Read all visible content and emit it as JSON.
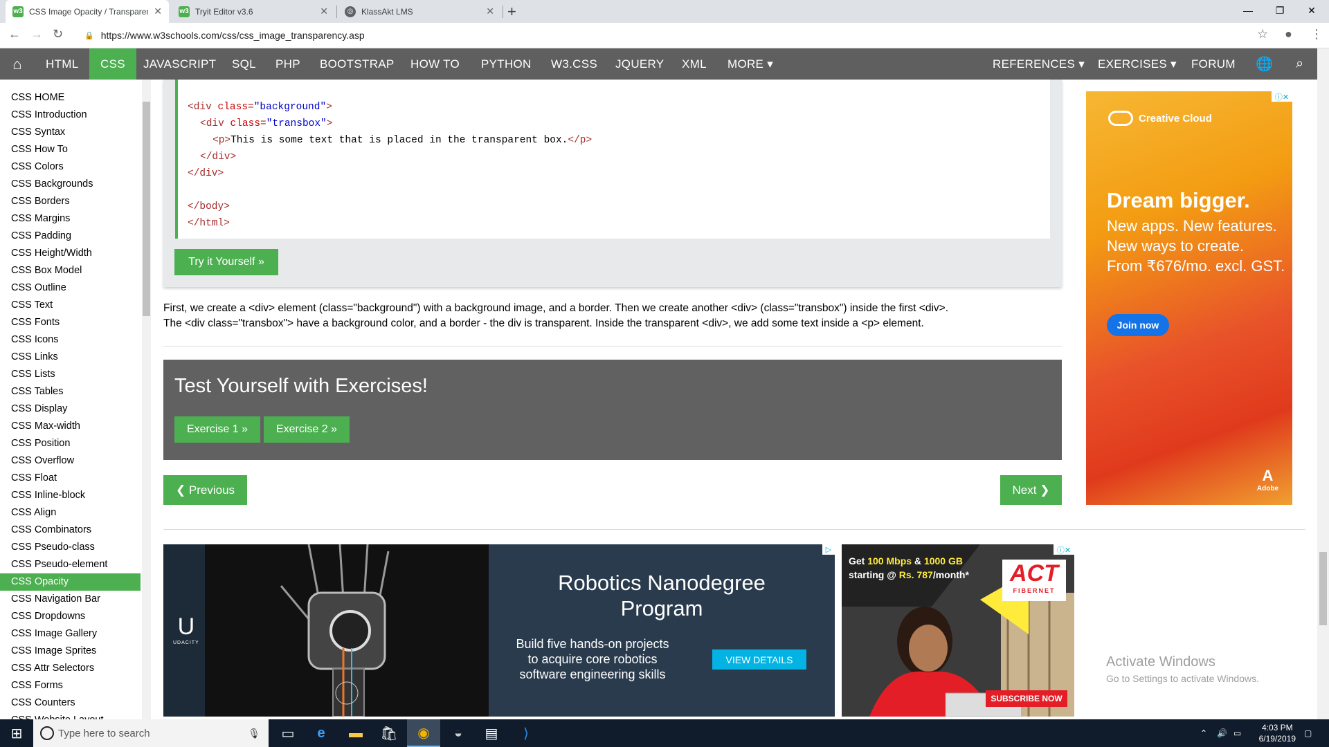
{
  "browser": {
    "tabs": [
      {
        "title": "CSS Image Opacity / Transparency",
        "active": true
      },
      {
        "title": "Tryit Editor v3.6",
        "active": false
      },
      {
        "title": "KlassAkt LMS",
        "active": false
      }
    ],
    "url": "https://www.w3schools.com/css/css_image_transparency.asp"
  },
  "navbar": {
    "items": [
      "HTML",
      "CSS",
      "JAVASCRIPT",
      "SQL",
      "PHP",
      "BOOTSTRAP",
      "HOW TO",
      "PYTHON",
      "W3.CSS",
      "JQUERY",
      "XML",
      "MORE ▾"
    ],
    "right_items": [
      "REFERENCES ▾",
      "EXERCISES ▾",
      "FORUM"
    ],
    "active": "CSS"
  },
  "sidebar": {
    "items": [
      "CSS HOME",
      "CSS Introduction",
      "CSS Syntax",
      "CSS How To",
      "CSS Colors",
      "CSS Backgrounds",
      "CSS Borders",
      "CSS Margins",
      "CSS Padding",
      "CSS Height/Width",
      "CSS Box Model",
      "CSS Outline",
      "CSS Text",
      "CSS Fonts",
      "CSS Icons",
      "CSS Links",
      "CSS Lists",
      "CSS Tables",
      "CSS Display",
      "CSS Max-width",
      "CSS Position",
      "CSS Overflow",
      "CSS Float",
      "CSS Inline-block",
      "CSS Align",
      "CSS Combinators",
      "CSS Pseudo-class",
      "CSS Pseudo-element",
      "CSS Opacity",
      "CSS Navigation Bar",
      "CSS Dropdowns",
      "CSS Image Gallery",
      "CSS Image Sprites",
      "CSS Attr Selectors",
      "CSS Forms",
      "CSS Counters",
      "CSS Website Layout"
    ],
    "active": "CSS Opacity"
  },
  "code": {
    "line1_open": "<div ",
    "line1_attr": "class",
    "line1_eq": "=",
    "line1_val": "\"background\"",
    "line1_close": ">",
    "line2_open": "<div ",
    "line2_attr": "class",
    "line2_eq": "=",
    "line2_val": "\"transbox\"",
    "line2_close": ">",
    "line3_open": "<p>",
    "line3_text": "This is some text that is placed in the transparent box.",
    "line3_close": "</p>",
    "line4": "</div>",
    "line5": "</div>",
    "line6": "</body>",
    "line7": "</html>"
  },
  "try_button": "Try it Yourself »",
  "description": {
    "line1": "First, we create a <div> element (class=\"background\") with a background image, and a border. Then we create another <div> (class=\"transbox\") inside the first <div>.",
    "line2": "The <div class=\"transbox\"> have a background color, and a border - the div is transparent. Inside the transparent <div>, we add some text inside a <p> element."
  },
  "exercises": {
    "title": "Test Yourself with Exercises!",
    "buttons": [
      "Exercise 1 »",
      "Exercise 2 »"
    ]
  },
  "pager": {
    "previous": "❮ Previous",
    "next": "Next ❯"
  },
  "ad_right": {
    "brand": "Creative Cloud",
    "headline": "Dream bigger.",
    "lines": [
      "New apps. New features.",
      "New ways to create.",
      "From ₹676/mo. excl. GST."
    ],
    "cta": "Join now",
    "adobe": "Adobe"
  },
  "ad_udacity": {
    "brand": "UDACITY",
    "title_line1": "Robotics Nanodegree",
    "title_line2": "Program",
    "sub_line1": "Build five hands-on projects",
    "sub_line2": "to acquire core robotics",
    "sub_line3": "software engineering skills",
    "cta": "VIEW DETAILS"
  },
  "ad_act": {
    "line1_pre": "Get ",
    "line1_b1": "100 Mbps",
    "line1_mid": " & ",
    "line1_b2": "1000 GB",
    "line2_pre": "starting @ ",
    "line2_b": "Rs. 787",
    "line2_post": "/month*",
    "logo": "ACT",
    "logo_sub": "FIBERNET",
    "cta": "SUBSCRIBE NOW"
  },
  "windows_watermark": {
    "line1": "Activate Windows",
    "line2": "Go to Settings to activate Windows."
  },
  "taskbar": {
    "search_placeholder": "Type here to search",
    "time": "4:03 PM",
    "date": "6/19/2019"
  },
  "colors": {
    "accent": "#4caf50",
    "navbar": "#5f5f5f",
    "exercise_bg": "#616161"
  }
}
